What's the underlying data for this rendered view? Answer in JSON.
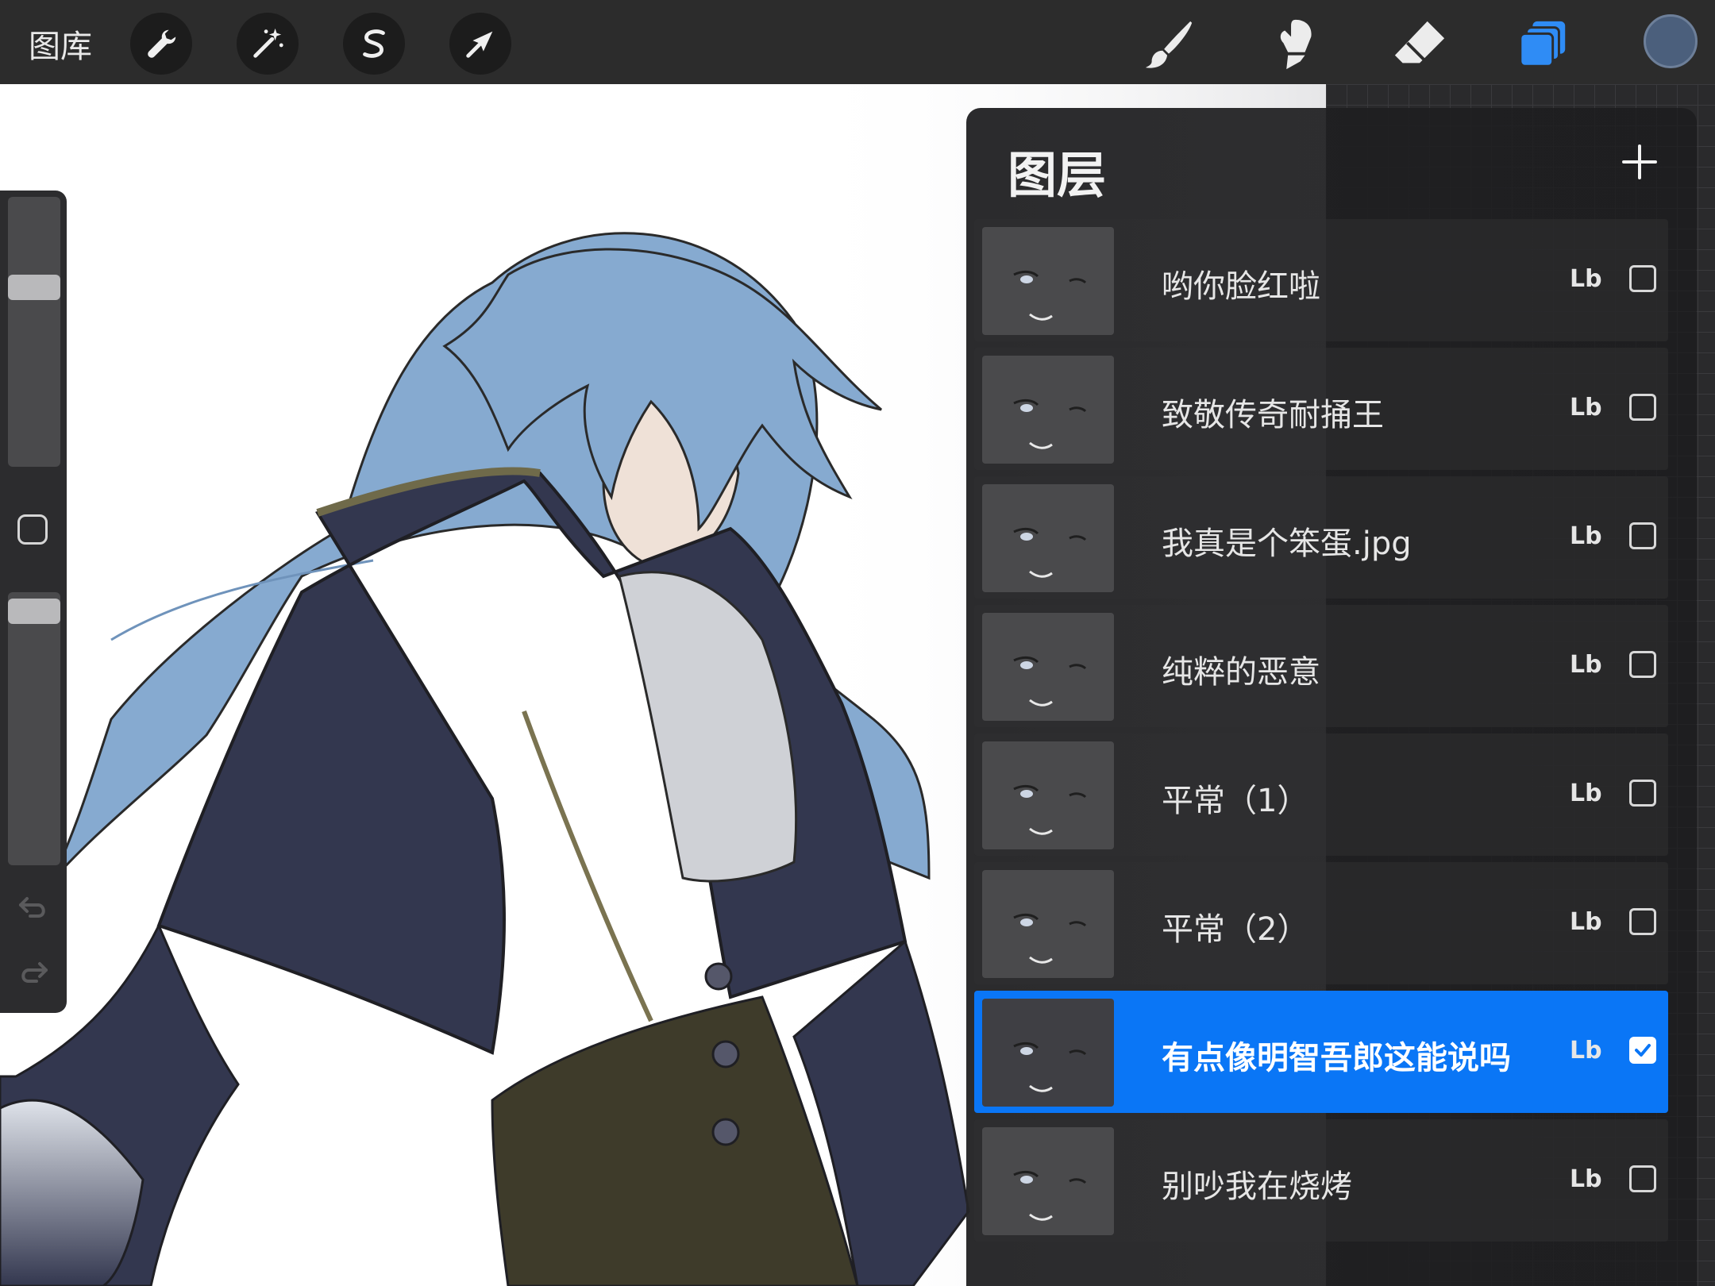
{
  "toolbar": {
    "gallery_label": "图库",
    "left_tools": [
      {
        "name": "actions",
        "icon": "wrench-icon"
      },
      {
        "name": "adjustments",
        "icon": "magic-wand-icon"
      },
      {
        "name": "selection",
        "icon": "selection-s-icon"
      },
      {
        "name": "transform",
        "icon": "arrow-cursor-icon"
      }
    ],
    "right_tools": [
      {
        "name": "brush",
        "icon": "brush-icon"
      },
      {
        "name": "smudge",
        "icon": "smudge-finger-icon"
      },
      {
        "name": "eraser",
        "icon": "eraser-icon"
      },
      {
        "name": "layers",
        "icon": "layers-icon",
        "active": true,
        "color": "#2f8cf5"
      }
    ],
    "current_color": "#4b5f7c"
  },
  "sidebar": {
    "brush_size_level": 0.45,
    "opacity_level": 0.95
  },
  "layers_panel": {
    "title": "图层",
    "add_label": "+",
    "layers": [
      {
        "name": "哟你脸红啦",
        "blend": "Lb",
        "visible": false,
        "active": false
      },
      {
        "name": "致敬传奇耐捅王",
        "blend": "Lb",
        "visible": false,
        "active": false
      },
      {
        "name": "我真是个笨蛋.jpg",
        "blend": "Lb",
        "visible": false,
        "active": false
      },
      {
        "name": "纯粹的恶意",
        "blend": "Lb",
        "visible": false,
        "active": false
      },
      {
        "name": "平常（1）",
        "blend": "Lb",
        "visible": false,
        "active": false
      },
      {
        "name": "平常（2）",
        "blend": "Lb",
        "visible": false,
        "active": false
      },
      {
        "name": "有点像明智吾郎这能说吗",
        "blend": "Lb",
        "visible": true,
        "active": true
      },
      {
        "name": "别吵我在烧烤",
        "blend": "Lb",
        "visible": false,
        "active": false
      }
    ]
  },
  "colors": {
    "accent": "#0a76f6",
    "hair": "#86aad0",
    "coat": "#33374f",
    "pants": "#3e3b2a"
  }
}
